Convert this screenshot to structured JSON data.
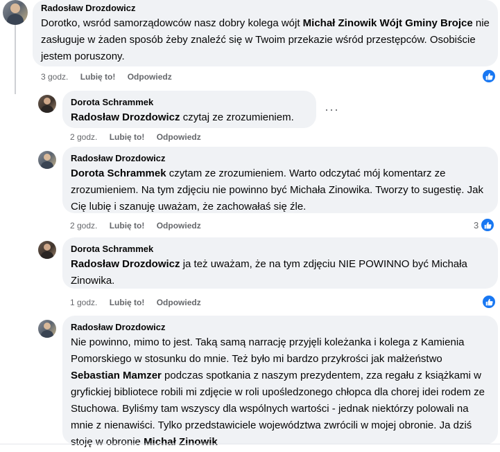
{
  "colors": {
    "bubble_bg": "#f0f2f5",
    "meta_text": "#65676b",
    "like_blue": "#1877f2"
  },
  "comments": [
    {
      "author": "Radosław Drozdowicz",
      "parts": [
        "Dorotko, wsród samorządowców nasz dobry kolega wójt ",
        "Michał Zinowik Wójt Gminy Brojce",
        " nie zasługuje w żaden sposób żeby znaleźć się w Twoim przekazie wśród przestępców. Osobiście jestem poruszony."
      ],
      "time": "3 godz.",
      "like": "Lubię to!",
      "reply": "Odpowiedz",
      "reaction_icon": "like-icon"
    },
    {
      "author": "Dorota Schrammek",
      "parts": [
        "Radosław Drozdowicz",
        " czytaj ze zrozumieniem."
      ],
      "time": "2 godz.",
      "like": "Lubię to!",
      "reply": "Odpowiedz",
      "more": "···"
    },
    {
      "author": "Radosław Drozdowicz",
      "parts": [
        "Dorota Schrammek",
        " czytam ze zrozumieniem. Warto odczytać mój komentarz ze zrozumieniem. Na tym zdjęciu nie powinno być Michała Zinowika. Tworzy to sugestię. Jak Cię lubię i szanuję uważam, że zachowałaś się źle."
      ],
      "time": "2 godz.",
      "like": "Lubię to!",
      "reply": "Odpowiedz",
      "reaction_count": "3",
      "reaction_icon": "like-icon"
    },
    {
      "author": "Dorota Schrammek",
      "parts": [
        "Radosław Drozdowicz",
        " ja też uważam, że na tym zdjęciu NIE POWINNO być Michała Zinowika."
      ],
      "time": "1 godz.",
      "like": "Lubię to!",
      "reply": "Odpowiedz",
      "reaction_icon": "like-icon"
    },
    {
      "author": "Radosław Drozdowicz",
      "parts": [
        "Nie powinno, mimo to jest. Taką samą narrację przyjęli koleżanka i kolega z Kamienia Pomorskiego w stosunku do mnie. Też było mi bardzo przykrości jak małżeństwo ",
        "Sebastian Mamzer",
        " podczas spotkania z naszym prezydentem, zza regału z książkami w gryfickiej bibliotece robili mi zdjęcie w roli upośledzonego chłopca dla chorej idei rodem ze Stuchowa. Byliśmy tam wszyscy dla wspólnych wartości - jednak niektórzy polowali na mnie z nienawiści. Tylko przedstawiciele województwa zwrócili w mojej obronie. Ja dziś stoję w obronie ",
        "Michał Zinowik"
      ]
    }
  ]
}
